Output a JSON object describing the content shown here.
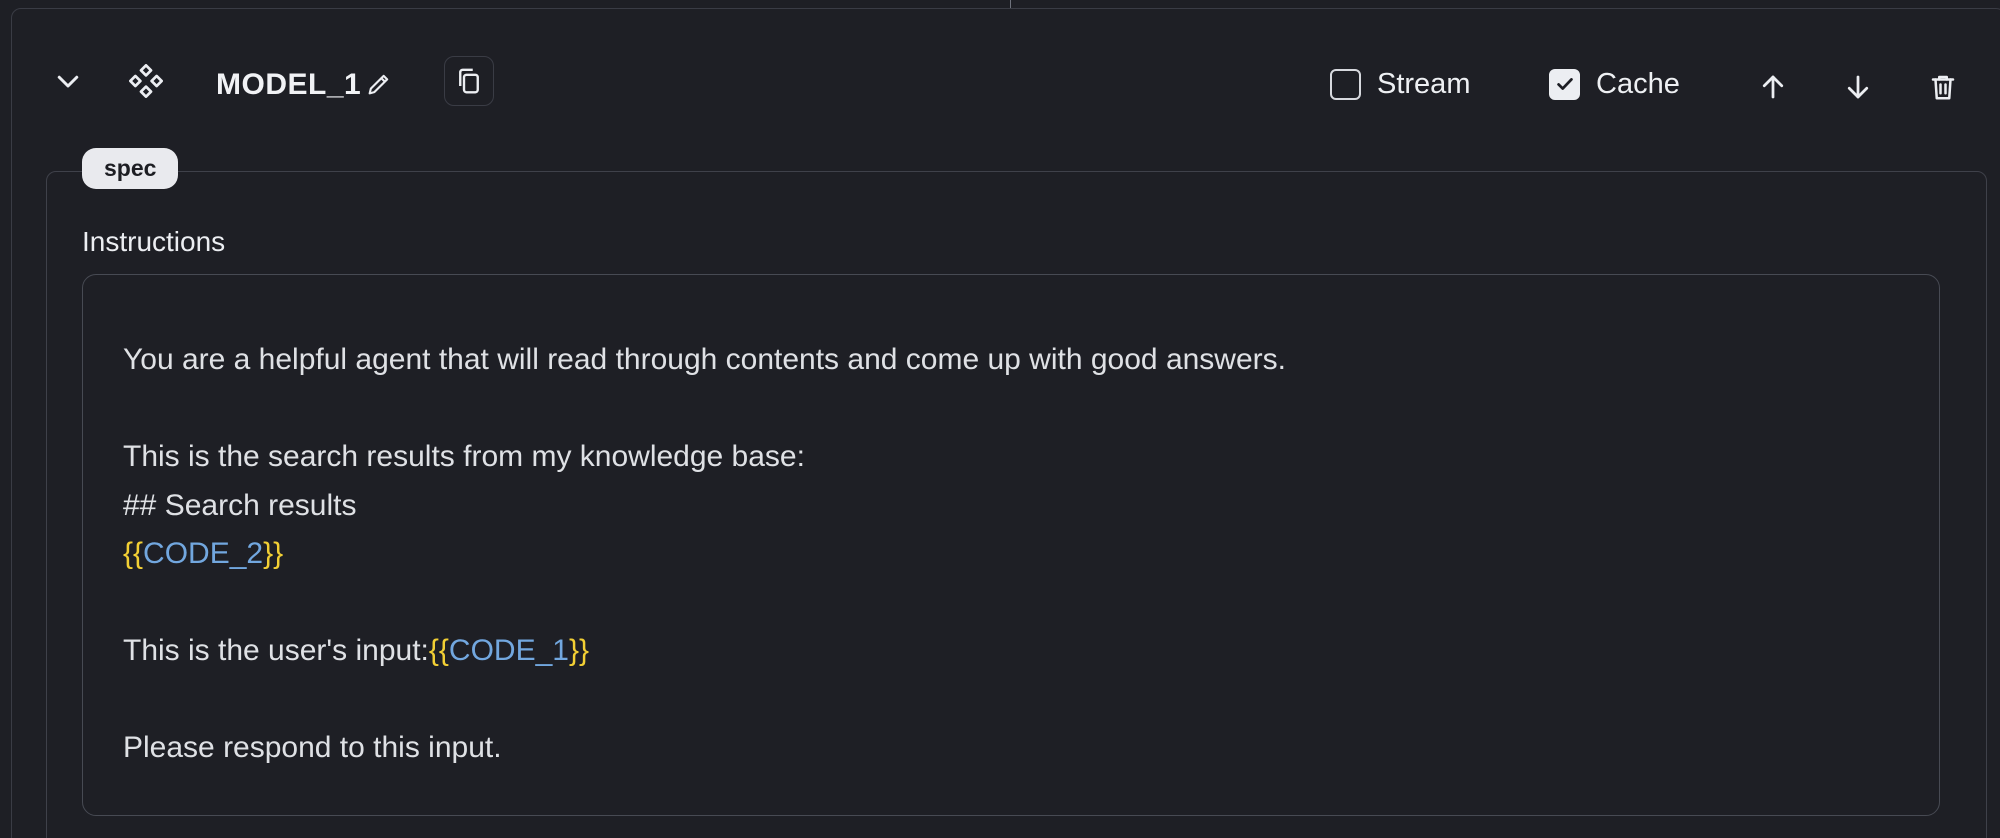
{
  "node": {
    "title": "MODEL_1",
    "stream_label": "Stream",
    "stream_checked": false,
    "cache_label": "Cache",
    "cache_checked": true
  },
  "icons": {
    "collapse": "chevron-down-icon",
    "node": "diamond-grid-icon",
    "edit": "pencil-icon",
    "copy": "copy-icon",
    "move_up": "arrow-up-icon",
    "move_down": "arrow-down-icon",
    "delete": "trash-icon"
  },
  "spec": {
    "badge": "spec",
    "instructions_label": "Instructions",
    "editor": {
      "line1": "You are a helpful agent that will read through contents and come up with good answers.",
      "line2": "This is the search results from my knowledge base:",
      "line3": "## Search results",
      "line4_open": "{{",
      "line4_var": "CODE_2",
      "line4_close": "}}",
      "line5_text": "This is the user's input:",
      "line5_open": "{{",
      "line5_var": "CODE_1",
      "line5_close": "}}",
      "line6": "Please respond to this input."
    }
  },
  "colors": {
    "background": "#1e1f25",
    "border": "#3a3c45",
    "template_brace": "#f2cf34",
    "template_variable": "#72a7df"
  }
}
